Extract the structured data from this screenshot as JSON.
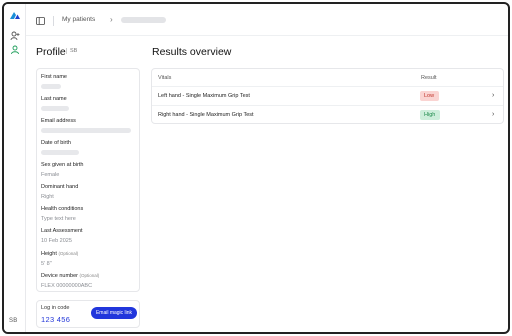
{
  "nav": {
    "initials": "SB"
  },
  "breadcrumb": {
    "root": "My patients",
    "separator": "›"
  },
  "profile": {
    "title": "Profile",
    "badge": "SB",
    "fields": [
      {
        "label": "First name",
        "value": ""
      },
      {
        "label": "Last name",
        "value": ""
      },
      {
        "label": "Email address",
        "value": ""
      },
      {
        "label": "Date of birth",
        "value": ""
      },
      {
        "label": "Sex given at birth",
        "value": "Female"
      },
      {
        "label": "Dominant hand",
        "value": "Right"
      },
      {
        "label": "Health conditions",
        "value": "Type text here"
      },
      {
        "label": "Last Assessment",
        "value": "10 Feb 2025"
      },
      {
        "label": "Height",
        "optional": "(Optional)",
        "value": "5' 8\""
      },
      {
        "label": "Device number",
        "optional": "(Optional)",
        "value": "FLEX 00000000ABC"
      }
    ]
  },
  "login": {
    "label": "Log in code",
    "code": "123 456",
    "button": "Email magic link"
  },
  "results": {
    "title": "Results overview",
    "columns": {
      "vitals": "Vitals",
      "result": "Result"
    },
    "rows": [
      {
        "vital": "Left hand - Single Maximum Grip Test",
        "result": "Low",
        "status_color": "#c0342b"
      },
      {
        "vital": "Right hand - Single Maximum Grip Test",
        "result": "High",
        "status_color": "#1e8a4c"
      }
    ],
    "chevron": "›"
  },
  "colors": {
    "accent": "#2136dc",
    "low_bg": "#fad4d2",
    "high_bg": "#cdeedb"
  }
}
